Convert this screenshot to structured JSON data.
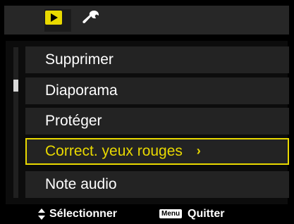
{
  "tabs": [
    {
      "icon": "play-icon",
      "active": true
    },
    {
      "icon": "wrench-icon",
      "active": false
    }
  ],
  "menu": {
    "items": [
      {
        "label": "Supprimer"
      },
      {
        "label": "Diaporama"
      },
      {
        "label": "Protéger"
      },
      {
        "label": "Correct. yeux rouges",
        "arrow": "›",
        "selected": true
      },
      {
        "label": "Note audio"
      }
    ]
  },
  "scrollbar": {
    "thumb_position": 0.2
  },
  "hints": {
    "select_label": "Sélectionner",
    "menu_key": "Menu",
    "quit_label": "Quitter"
  },
  "colors": {
    "accent": "#e9d900",
    "item_bg": "#232323",
    "background": "#000000",
    "text": "#ffffff"
  }
}
